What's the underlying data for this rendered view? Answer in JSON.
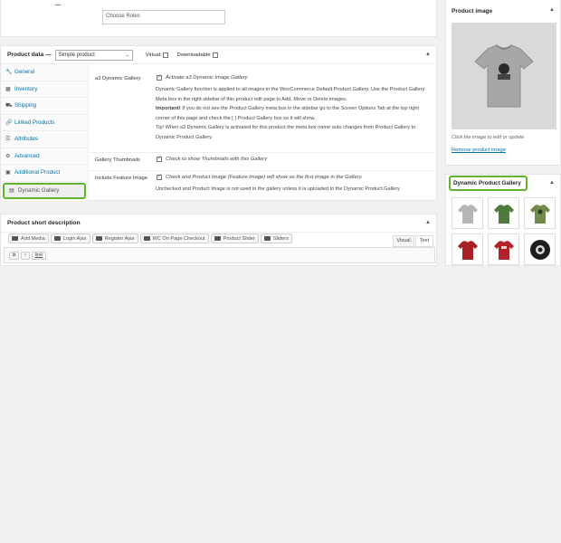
{
  "roles": {
    "placeholder": "Choose Roles"
  },
  "product_data": {
    "label": "Product data —",
    "type_select": "Simple product",
    "virtual_label": "Virtual:",
    "downloadable_label": "Downloadable:",
    "tabs": [
      {
        "label": "General",
        "icon": "wrench-icon"
      },
      {
        "label": "Inventory",
        "icon": "inventory-icon"
      },
      {
        "label": "Shipping",
        "icon": "truck-icon"
      },
      {
        "label": "Linked Products",
        "icon": "link-icon"
      },
      {
        "label": "Attributes",
        "icon": "list-icon"
      },
      {
        "label": "Advanced",
        "icon": "gear-icon"
      },
      {
        "label": "Additional Product",
        "icon": "plus-icon"
      },
      {
        "label": "Dynamic Gallery",
        "icon": "gallery-icon"
      }
    ],
    "dg_field_label": "a3 Dynamic Gallery",
    "dg_activate": "Activate a3 Dynamic Image Gallery",
    "dg_desc_1": "Dynamic Gallery function is applied to all images in the WooCommerce Default Product Gallery. Use the Product Gallery Meta box in the right sidebar of this product edit page to Add, Move or Delete images.",
    "dg_important_label": "Important!",
    "dg_important_text": " If you do not see the Product Gallery meta box in the sidebar go to the Screen Options Tab at the top right corner of this page and check the [ ] Product Gallery box so it will show.",
    "dg_tip": "Tip! When a3 Dynamic Gallery is activated for this product the meta box name auto changes from Product Gallery to Dynamic Product Gallery.",
    "thumbs_label": "Gallery Thumbnails",
    "thumbs_text": "Check to show Thumbnails with this Gallery",
    "feature_label": "Include Feature Image",
    "feature_text": "Check and Product Image (Feature Image) will show as the first image in the Gallery.",
    "feature_desc": "Unchecked and Product Image is not used in the gallery unless it is uploaded to the Dynamic Product Gallery"
  },
  "short_desc": {
    "title": "Product short description",
    "buttons": [
      "Add Media",
      "Login Ajax",
      "Register Ajax",
      "WC On Page Checkout",
      "Product Slider",
      "Sliders"
    ],
    "visual_tab": "Visual",
    "text_tab": "Text",
    "quicktags": [
      "b",
      "i",
      "link"
    ]
  },
  "product_image": {
    "title": "Product image",
    "hint": "Click the image to edit or update",
    "remove": "Remove product image"
  },
  "dynamic_gallery": {
    "title": "Dynamic Product Gallery",
    "thumbs": [
      {
        "name": "grey-tshirt-thumb",
        "color": "#b5b5b5"
      },
      {
        "name": "green-tshirt-thumb",
        "color": "#4e7a3c"
      },
      {
        "name": "olive-tshirt-thumb",
        "color": "#6f8a4a"
      },
      {
        "name": "red-tshirt-thumb",
        "color": "#a82024"
      },
      {
        "name": "red-print-tshirt-thumb",
        "color": "#b22226"
      },
      {
        "name": "black-badge-thumb",
        "color": "#1f1f1f"
      }
    ]
  },
  "colors": {
    "accent": "#62b42f",
    "link": "#0073aa"
  }
}
